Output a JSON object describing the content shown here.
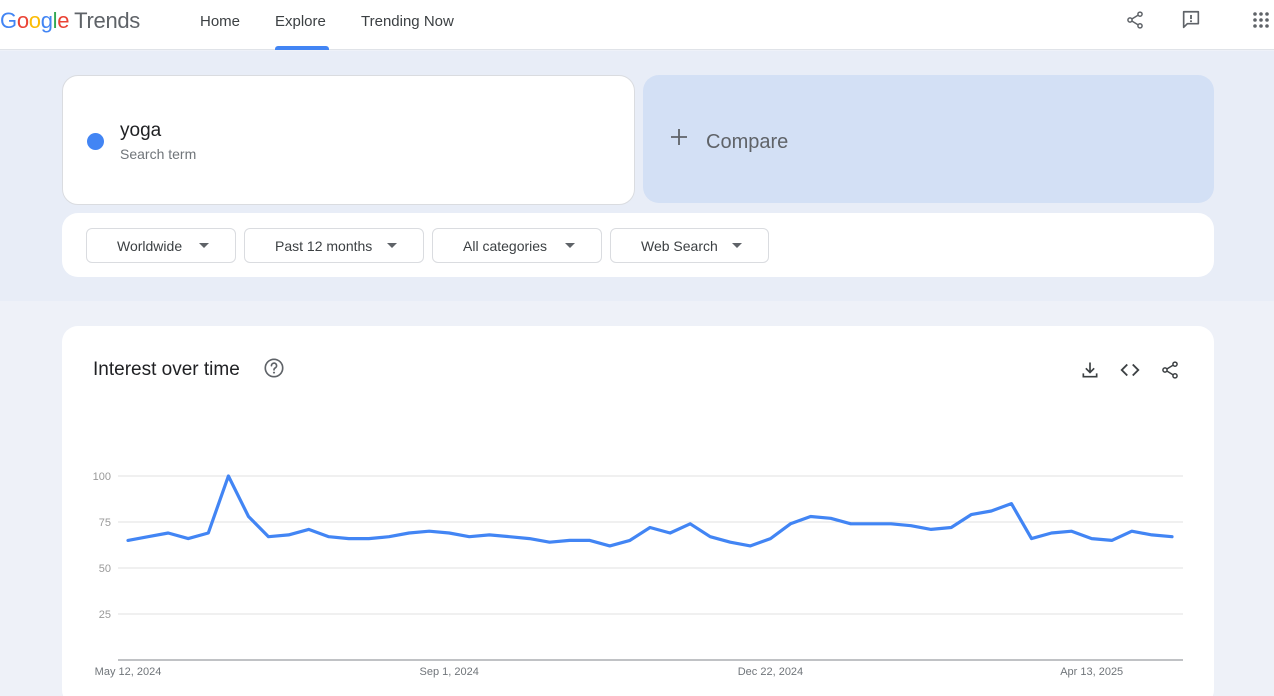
{
  "logo": {
    "google_letters": [
      "G",
      "o",
      "o",
      "g",
      "l",
      "e"
    ],
    "product": "Trends"
  },
  "nav": {
    "home": "Home",
    "explore": "Explore",
    "trending": "Trending Now"
  },
  "top_icons": [
    "share-icon",
    "feedback-icon",
    "apps-grid-icon"
  ],
  "search_term": {
    "name": "yoga",
    "subtitle": "Search term",
    "color": "#4285f4"
  },
  "compare": {
    "label": "Compare"
  },
  "filters": {
    "region": "Worldwide",
    "time": "Past 12 months",
    "category": "All categories",
    "property": "Web Search"
  },
  "interest_card": {
    "title": "Interest over time",
    "icons": [
      "download-icon",
      "embed-icon",
      "share-icon"
    ]
  },
  "chart_data": {
    "type": "line",
    "series": [
      {
        "color": "#4285f4",
        "values": [
          65,
          67,
          69,
          66,
          69,
          100,
          78,
          67,
          68,
          71,
          67,
          66,
          66,
          67,
          69,
          70,
          69,
          67,
          68,
          67,
          66,
          64,
          65,
          65,
          62,
          65,
          72,
          69,
          74,
          67,
          64,
          62,
          66,
          74,
          78,
          77,
          74,
          74,
          74,
          73,
          71,
          72,
          79,
          81,
          85,
          66,
          69,
          70,
          66,
          65,
          70,
          68,
          67
        ]
      }
    ],
    "x_tick_labels": [
      "May 12, 2024",
      "Sep 1, 2024",
      "Dec 22, 2024",
      "Apr 13, 2025"
    ],
    "x_tick_indices": [
      0,
      16,
      32,
      48
    ],
    "y_ticks": [
      100,
      75,
      50,
      25
    ],
    "ylim": [
      0,
      100
    ],
    "grid": true
  }
}
